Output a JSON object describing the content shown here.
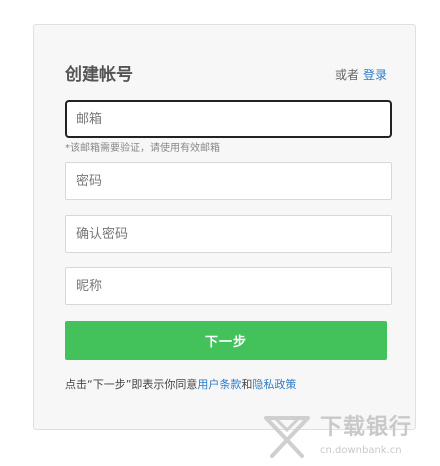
{
  "header": {
    "title": "创建帐号",
    "alt_prefix": "或者",
    "login_link": "登录"
  },
  "form": {
    "email": {
      "placeholder": "邮箱",
      "value": ""
    },
    "email_hint": "*该邮箱需要验证，请使用有效邮箱",
    "password": {
      "placeholder": "密码",
      "value": ""
    },
    "confirm_password": {
      "placeholder": "确认密码",
      "value": ""
    },
    "nickname": {
      "placeholder": "昵称",
      "value": ""
    },
    "next_button": "下一步"
  },
  "terms": {
    "prefix": "点击“下一步”即表示你同意",
    "user_terms": "用户条款",
    "and": "和",
    "privacy_policy": "隐私政策"
  },
  "watermark": {
    "name": "下载银行",
    "url": "cn.downbank.cn"
  },
  "colors": {
    "accent_green": "#43c15a",
    "link_blue": "#2d7cc8",
    "card_bg": "#f7f7f7"
  }
}
